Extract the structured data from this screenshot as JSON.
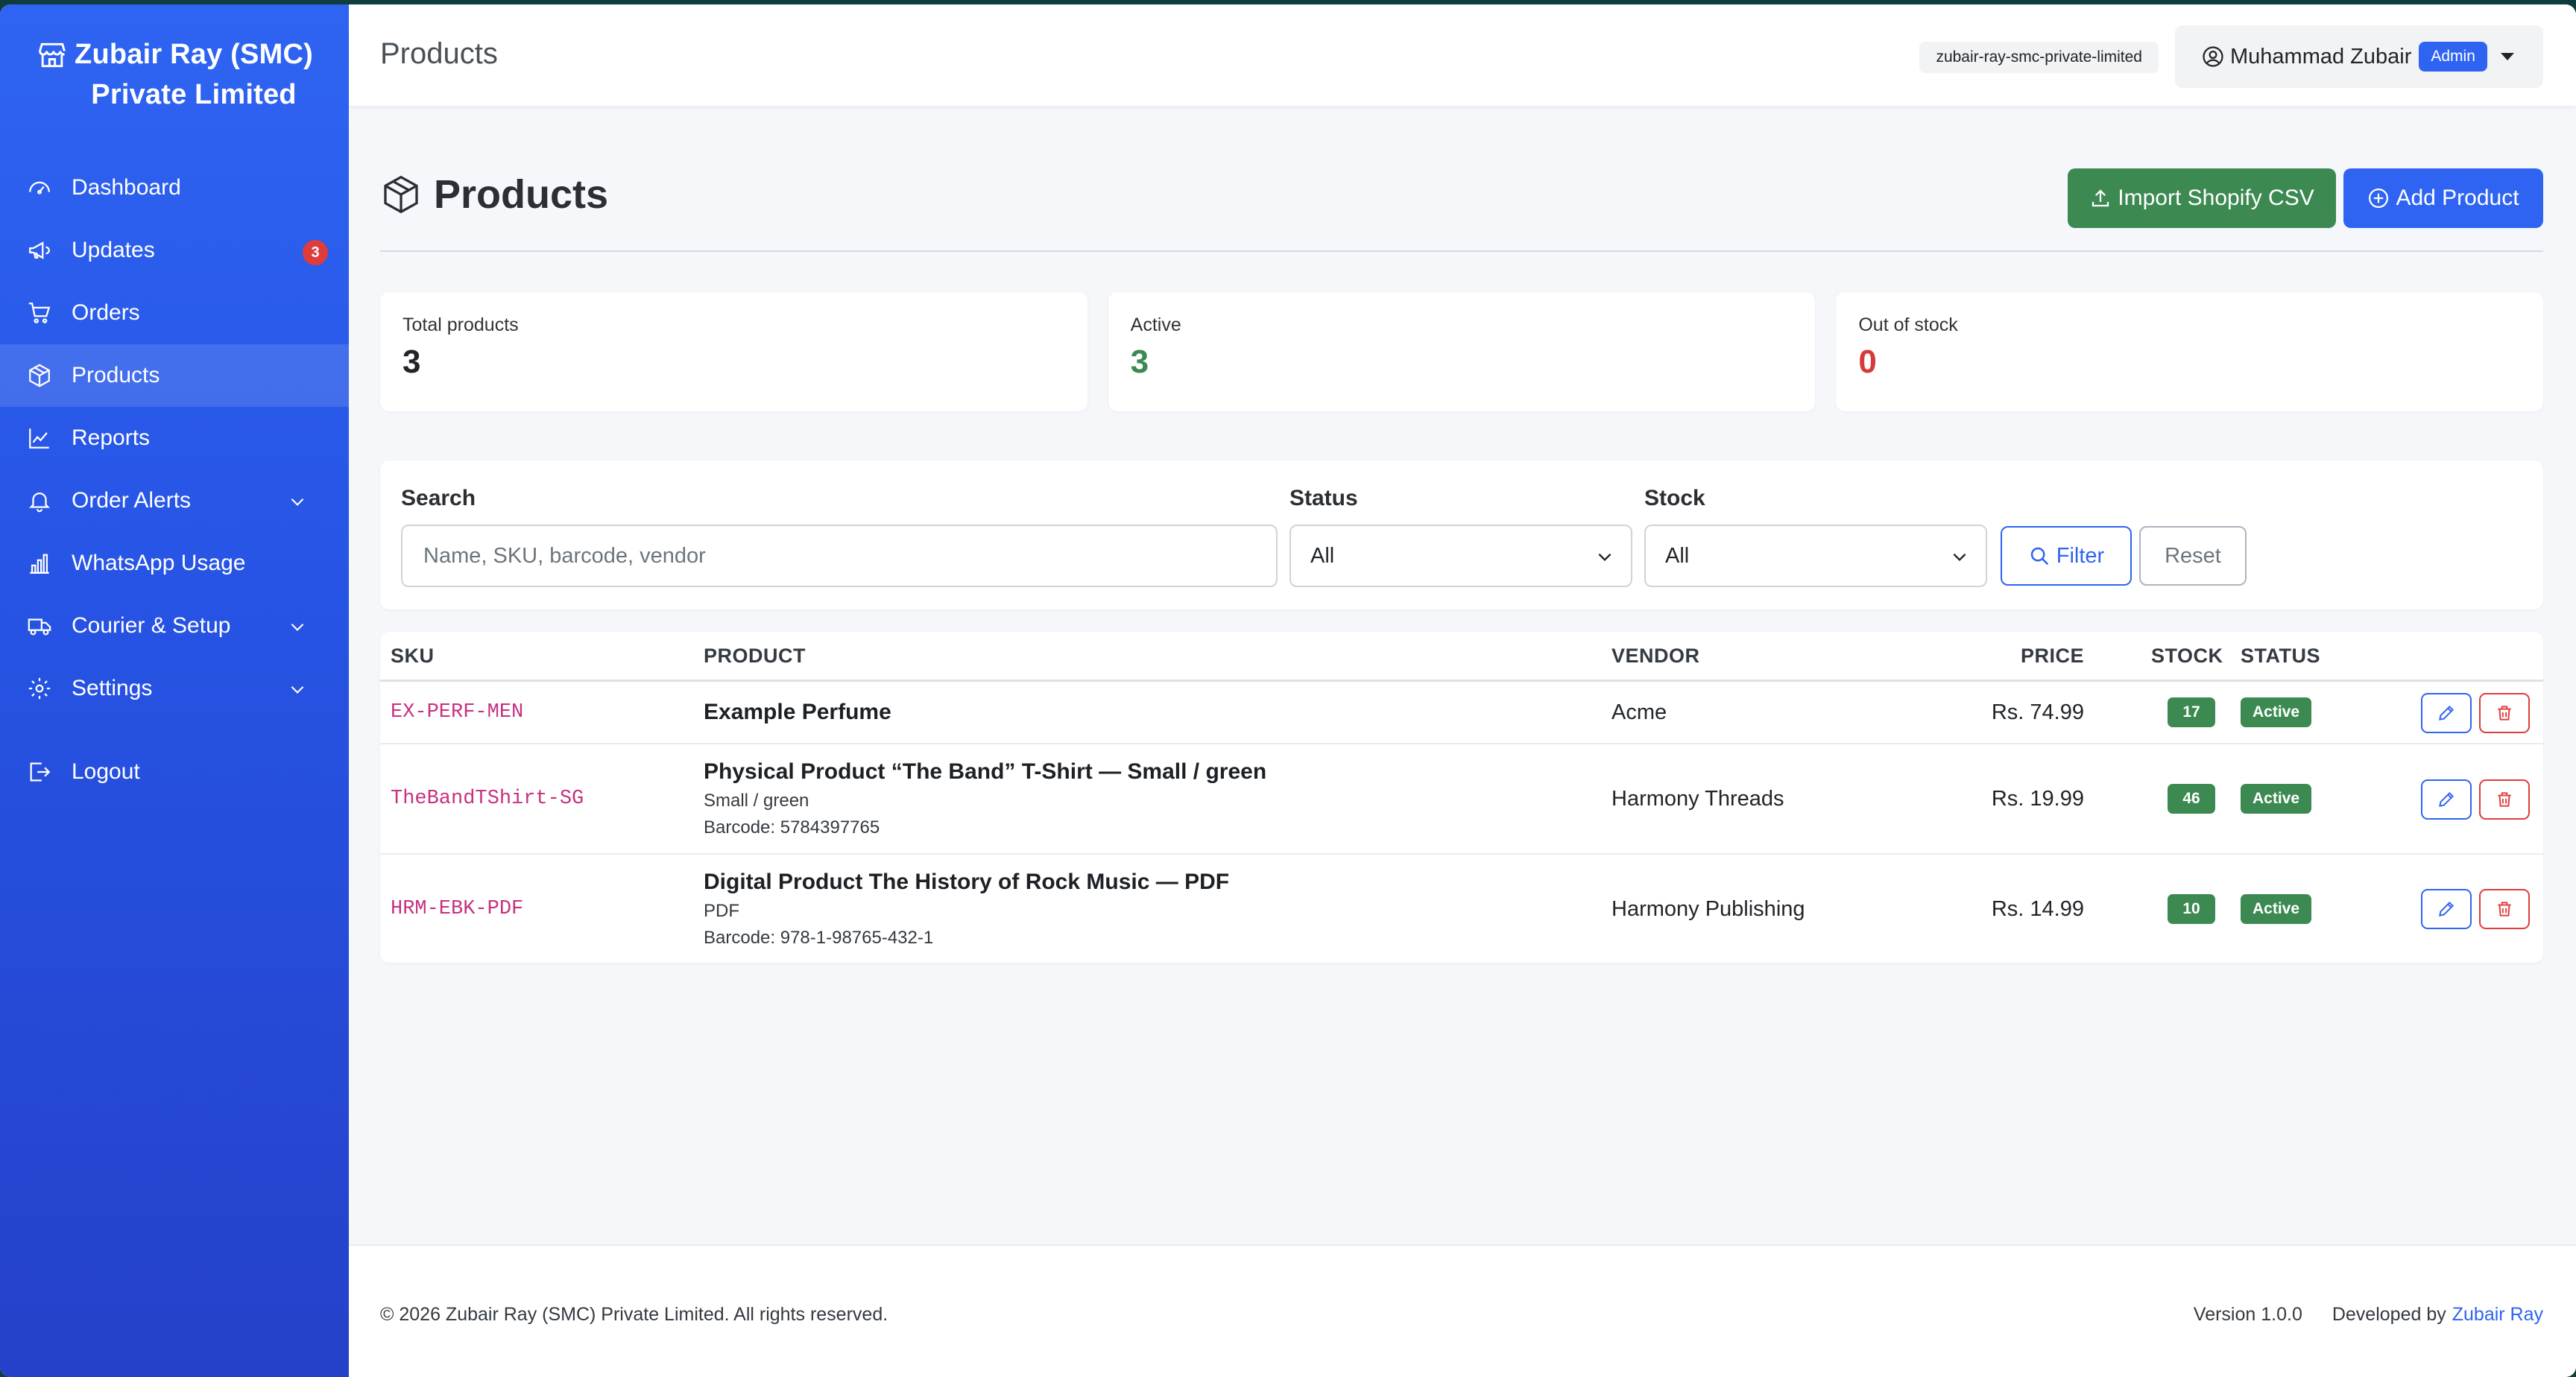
{
  "brand": {
    "name": "Zubair Ray (SMC) Private Limited",
    "line1": "Zubair Ray (SMC)",
    "line2": "Private Limited"
  },
  "sidebar": {
    "items": [
      {
        "label": "Dashboard",
        "icon": "dashboard-icon"
      },
      {
        "label": "Updates",
        "icon": "megaphone-icon",
        "badge": "3"
      },
      {
        "label": "Orders",
        "icon": "cart-icon"
      },
      {
        "label": "Products",
        "icon": "box-icon",
        "active": true
      },
      {
        "label": "Reports",
        "icon": "line-chart-icon"
      },
      {
        "label": "Order Alerts",
        "icon": "bell-icon",
        "expandable": true
      },
      {
        "label": "WhatsApp Usage",
        "icon": "bar-chart-icon"
      },
      {
        "label": "Courier & Setup",
        "icon": "truck-icon",
        "expandable": true
      },
      {
        "label": "Settings",
        "icon": "gear-icon",
        "expandable": true
      },
      {
        "label": "Logout",
        "icon": "logout-icon"
      }
    ]
  },
  "topbar": {
    "title": "Products",
    "slug": "zubair-ray-smc-private-limited",
    "user_name": "Muhammad Zubair",
    "role": "Admin"
  },
  "page": {
    "title": "Products",
    "import_label": "Import Shopify CSV",
    "add_label": "Add Product"
  },
  "stats": [
    {
      "label": "Total products",
      "value": "3",
      "color": "#212529"
    },
    {
      "label": "Active",
      "value": "3",
      "color": "#3c8a52"
    },
    {
      "label": "Out of stock",
      "value": "0",
      "color": "#d63a3a"
    }
  ],
  "filters": {
    "search_label": "Search",
    "search_placeholder": "Name, SKU, barcode, vendor",
    "search_value": "",
    "status_label": "Status",
    "status_value": "All",
    "stock_label": "Stock",
    "stock_value": "All",
    "filter_label": "Filter",
    "reset_label": "Reset"
  },
  "table": {
    "headers": {
      "sku": "SKU",
      "product": "PRODUCT",
      "vendor": "VENDOR",
      "price": "PRICE",
      "stock": "STOCK",
      "status": "STATUS"
    },
    "rows": [
      {
        "sku": "EX-PERF-MEN",
        "name": "Example Perfume",
        "variant": "",
        "barcode": "",
        "vendor": "Acme",
        "price": "Rs. 74.99",
        "stock": "17",
        "status": "Active"
      },
      {
        "sku": "TheBandTShirt-SG",
        "name": "Physical Product “The Band” T-Shirt — Small / green",
        "variant": "Small / green",
        "barcode": "Barcode: 5784397765",
        "vendor": "Harmony Threads",
        "price": "Rs. 19.99",
        "stock": "46",
        "status": "Active"
      },
      {
        "sku": "HRM-EBK-PDF",
        "name": "Digital Product The History of Rock Music — PDF",
        "variant": "PDF",
        "barcode": "Barcode: 978-1-98765-432-1",
        "vendor": "Harmony Publishing",
        "price": "Rs. 14.99",
        "stock": "10",
        "status": "Active"
      }
    ]
  },
  "footer": {
    "copyright": "© 2026 Zubair Ray (SMC) Private Limited. All rights reserved.",
    "version": "Version 1.0.0",
    "developed_by": "Developed by",
    "developer": "Zubair Ray"
  },
  "colors": {
    "primary": "#2f64f2",
    "success": "#3c8a52",
    "danger": "#e03c3c",
    "sku": "#c7317f"
  }
}
